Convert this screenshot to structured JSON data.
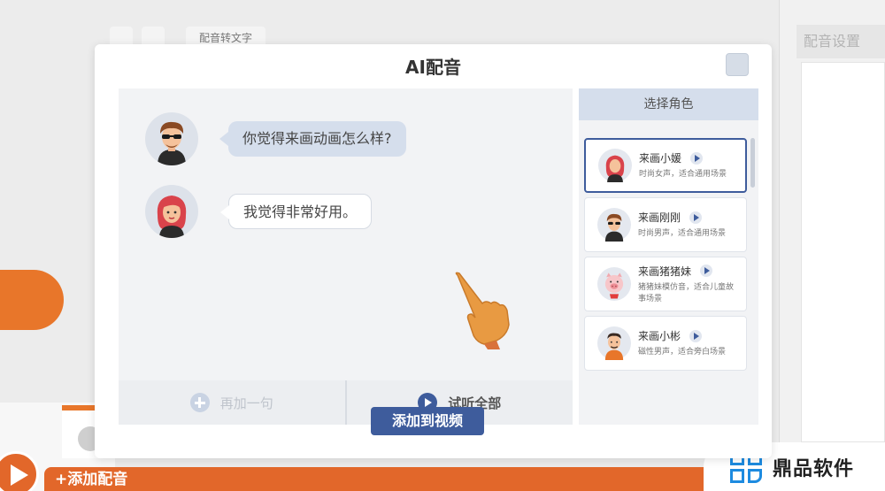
{
  "background": {
    "tab_label": "配音转文字",
    "right_panel_title": "配音设置",
    "bottom_bar_label": "+添加配音",
    "brand_name": "鼎品软件"
  },
  "dialog": {
    "title": "AI配音",
    "messages": [
      {
        "speaker": "male",
        "text": "你觉得来画动画怎么样?"
      },
      {
        "speaker": "female",
        "text": "我觉得非常好用。"
      }
    ],
    "actions": {
      "add_sentence": "再加一句",
      "listen_all": "试听全部"
    },
    "role_panel": {
      "header": "选择角色",
      "roles": [
        {
          "name": "来画小媛",
          "desc": "时尚女声，适合通用场景",
          "selected": true
        },
        {
          "name": "来画刚刚",
          "desc": "时尚男声，适合通用场景",
          "selected": false
        },
        {
          "name": "来画猪猪妹",
          "desc": "猪猪妹模仿音，适合儿童故事场景",
          "selected": false
        },
        {
          "name": "来画小彬",
          "desc": "磁性男声，适合旁白场景",
          "selected": false
        }
      ]
    },
    "add_to_video": "添加到视频"
  },
  "colors": {
    "accent": "#3e5c9c",
    "brand_orange": "#e2672a",
    "bubble_blue": "#d5deec"
  },
  "icons": [
    "close-icon",
    "plus-circle-icon",
    "play-circle-icon",
    "play-icon",
    "pointing-hand-icon",
    "brand-logo-icon"
  ]
}
